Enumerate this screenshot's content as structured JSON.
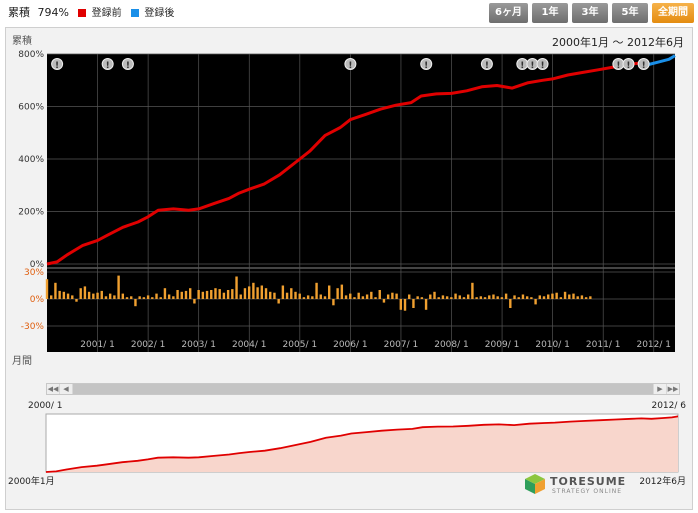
{
  "header": {
    "cum_label": "累積",
    "cum_value": "794%",
    "legend": [
      {
        "label": "登録前",
        "color": "#e00000"
      },
      {
        "label": "登録後",
        "color": "#1a8fe8"
      }
    ],
    "range_buttons": [
      {
        "label": "6ヶ月",
        "active": false
      },
      {
        "label": "1年",
        "active": false
      },
      {
        "label": "3年",
        "active": false
      },
      {
        "label": "5年",
        "active": false
      },
      {
        "label": "全期間",
        "active": true
      }
    ]
  },
  "main": {
    "period_text": "2000年1月 ～ 2012年6月",
    "top_axis_label": "累積",
    "bottom_axis_label": "月間"
  },
  "overview": {
    "start_top": "2000/ 1",
    "end_top": "2012/ 6",
    "start_bottom": "2000年1月",
    "end_bottom": "2012年6月"
  },
  "logo": {
    "text": "TORESUME",
    "sub": "STRATEGY ONLINE"
  },
  "chart_data": [
    {
      "type": "line",
      "name": "cumulative",
      "ylim": [
        0,
        800
      ],
      "y_ticks": [
        "0%",
        "200%",
        "400%",
        "600%",
        "800%"
      ],
      "x_ticks": [
        "2001/ 1",
        "2002/ 1",
        "2003/ 1",
        "2004/ 1",
        "2005/ 1",
        "2006/ 1",
        "2007/ 1",
        "2008/ 1",
        "2009/ 1",
        "2010/ 1",
        "2011/ 1",
        "2012/ 1"
      ],
      "xlim": [
        2000.0,
        2012.42
      ],
      "series": [
        {
          "name": "登録前",
          "color": "#e00000",
          "x": [
            2000.0,
            2000.2,
            2000.4,
            2000.7,
            2001.0,
            2001.2,
            2001.5,
            2001.8,
            2002.0,
            2002.2,
            2002.5,
            2002.8,
            2003.0,
            2003.3,
            2003.6,
            2003.8,
            2004.0,
            2004.3,
            2004.6,
            2004.8,
            2005.0,
            2005.2,
            2005.5,
            2005.8,
            2006.0,
            2006.3,
            2006.6,
            2006.9,
            2007.2,
            2007.4,
            2007.7,
            2008.0,
            2008.3,
            2008.6,
            2008.9,
            2009.2,
            2009.5,
            2009.8,
            2010.0,
            2010.3,
            2010.6,
            2010.9,
            2011.2,
            2011.5,
            2011.7
          ],
          "y": [
            0,
            8,
            35,
            70,
            90,
            110,
            140,
            160,
            180,
            205,
            210,
            205,
            210,
            230,
            250,
            270,
            285,
            305,
            340,
            370,
            400,
            430,
            490,
            520,
            550,
            570,
            590,
            605,
            615,
            640,
            648,
            650,
            660,
            675,
            680,
            670,
            690,
            700,
            705,
            720,
            730,
            740,
            750,
            760,
            765
          ]
        },
        {
          "name": "登録後",
          "color": "#1a8fe8",
          "x": [
            2011.7,
            2011.9,
            2012.1,
            2012.3,
            2012.42
          ],
          "y": [
            765,
            760,
            770,
            780,
            794
          ]
        }
      ]
    },
    {
      "type": "bar",
      "name": "monthly",
      "ylim": [
        -30,
        30
      ],
      "y_ticks": [
        "30%",
        "0%",
        "-30%"
      ],
      "color": "#f0a030",
      "x_start": 2000.0,
      "x_step": 0.0833,
      "values": [
        22,
        4,
        18,
        9,
        8,
        6,
        4,
        -3,
        12,
        14,
        8,
        6,
        7,
        9,
        3,
        6,
        4,
        26,
        6,
        2,
        3,
        -8,
        3,
        2,
        4,
        2,
        6,
        2,
        12,
        5,
        3,
        10,
        8,
        9,
        12,
        -5,
        10,
        8,
        9,
        10,
        12,
        11,
        7,
        10,
        11,
        25,
        5,
        12,
        14,
        18,
        13,
        15,
        12,
        8,
        7,
        -5,
        15,
        7,
        12,
        8,
        6,
        2,
        4,
        3,
        18,
        5,
        3,
        15,
        -7,
        12,
        16,
        4,
        6,
        2,
        7,
        3,
        5,
        8,
        2,
        10,
        -4,
        5,
        7,
        6,
        -12,
        -13,
        5,
        -10,
        3,
        2,
        -12,
        5,
        8,
        2,
        4,
        3,
        2,
        6,
        4,
        2,
        5,
        18,
        2,
        3,
        2,
        4,
        5,
        3,
        2,
        6,
        -10,
        4,
        2,
        5,
        3,
        2,
        -6,
        4,
        3,
        5,
        6,
        7,
        2,
        8,
        5,
        6,
        3,
        4,
        2,
        3
      ]
    }
  ],
  "markers": {
    "symbol": "!",
    "x": [
      2000.2,
      2001.2,
      2001.6,
      2006.0,
      2007.5,
      2008.7,
      2009.4,
      2009.6,
      2009.8,
      2011.3,
      2011.5,
      2011.8
    ]
  }
}
